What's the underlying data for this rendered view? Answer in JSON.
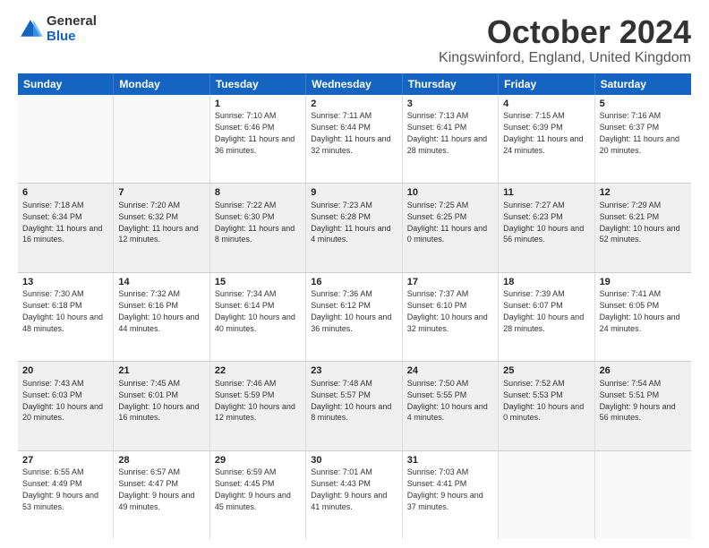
{
  "logo": {
    "general": "General",
    "blue": "Blue"
  },
  "title": "October 2024",
  "subtitle": "Kingswinford, England, United Kingdom",
  "days": [
    "Sunday",
    "Monday",
    "Tuesday",
    "Wednesday",
    "Thursday",
    "Friday",
    "Saturday"
  ],
  "weeks": [
    [
      {
        "day": "",
        "info": ""
      },
      {
        "day": "",
        "info": ""
      },
      {
        "day": "1",
        "info": "Sunrise: 7:10 AM\nSunset: 6:46 PM\nDaylight: 11 hours and 36 minutes."
      },
      {
        "day": "2",
        "info": "Sunrise: 7:11 AM\nSunset: 6:44 PM\nDaylight: 11 hours and 32 minutes."
      },
      {
        "day": "3",
        "info": "Sunrise: 7:13 AM\nSunset: 6:41 PM\nDaylight: 11 hours and 28 minutes."
      },
      {
        "day": "4",
        "info": "Sunrise: 7:15 AM\nSunset: 6:39 PM\nDaylight: 11 hours and 24 minutes."
      },
      {
        "day": "5",
        "info": "Sunrise: 7:16 AM\nSunset: 6:37 PM\nDaylight: 11 hours and 20 minutes."
      }
    ],
    [
      {
        "day": "6",
        "info": "Sunrise: 7:18 AM\nSunset: 6:34 PM\nDaylight: 11 hours and 16 minutes."
      },
      {
        "day": "7",
        "info": "Sunrise: 7:20 AM\nSunset: 6:32 PM\nDaylight: 11 hours and 12 minutes."
      },
      {
        "day": "8",
        "info": "Sunrise: 7:22 AM\nSunset: 6:30 PM\nDaylight: 11 hours and 8 minutes."
      },
      {
        "day": "9",
        "info": "Sunrise: 7:23 AM\nSunset: 6:28 PM\nDaylight: 11 hours and 4 minutes."
      },
      {
        "day": "10",
        "info": "Sunrise: 7:25 AM\nSunset: 6:25 PM\nDaylight: 11 hours and 0 minutes."
      },
      {
        "day": "11",
        "info": "Sunrise: 7:27 AM\nSunset: 6:23 PM\nDaylight: 10 hours and 56 minutes."
      },
      {
        "day": "12",
        "info": "Sunrise: 7:29 AM\nSunset: 6:21 PM\nDaylight: 10 hours and 52 minutes."
      }
    ],
    [
      {
        "day": "13",
        "info": "Sunrise: 7:30 AM\nSunset: 6:18 PM\nDaylight: 10 hours and 48 minutes."
      },
      {
        "day": "14",
        "info": "Sunrise: 7:32 AM\nSunset: 6:16 PM\nDaylight: 10 hours and 44 minutes."
      },
      {
        "day": "15",
        "info": "Sunrise: 7:34 AM\nSunset: 6:14 PM\nDaylight: 10 hours and 40 minutes."
      },
      {
        "day": "16",
        "info": "Sunrise: 7:36 AM\nSunset: 6:12 PM\nDaylight: 10 hours and 36 minutes."
      },
      {
        "day": "17",
        "info": "Sunrise: 7:37 AM\nSunset: 6:10 PM\nDaylight: 10 hours and 32 minutes."
      },
      {
        "day": "18",
        "info": "Sunrise: 7:39 AM\nSunset: 6:07 PM\nDaylight: 10 hours and 28 minutes."
      },
      {
        "day": "19",
        "info": "Sunrise: 7:41 AM\nSunset: 6:05 PM\nDaylight: 10 hours and 24 minutes."
      }
    ],
    [
      {
        "day": "20",
        "info": "Sunrise: 7:43 AM\nSunset: 6:03 PM\nDaylight: 10 hours and 20 minutes."
      },
      {
        "day": "21",
        "info": "Sunrise: 7:45 AM\nSunset: 6:01 PM\nDaylight: 10 hours and 16 minutes."
      },
      {
        "day": "22",
        "info": "Sunrise: 7:46 AM\nSunset: 5:59 PM\nDaylight: 10 hours and 12 minutes."
      },
      {
        "day": "23",
        "info": "Sunrise: 7:48 AM\nSunset: 5:57 PM\nDaylight: 10 hours and 8 minutes."
      },
      {
        "day": "24",
        "info": "Sunrise: 7:50 AM\nSunset: 5:55 PM\nDaylight: 10 hours and 4 minutes."
      },
      {
        "day": "25",
        "info": "Sunrise: 7:52 AM\nSunset: 5:53 PM\nDaylight: 10 hours and 0 minutes."
      },
      {
        "day": "26",
        "info": "Sunrise: 7:54 AM\nSunset: 5:51 PM\nDaylight: 9 hours and 56 minutes."
      }
    ],
    [
      {
        "day": "27",
        "info": "Sunrise: 6:55 AM\nSunset: 4:49 PM\nDaylight: 9 hours and 53 minutes."
      },
      {
        "day": "28",
        "info": "Sunrise: 6:57 AM\nSunset: 4:47 PM\nDaylight: 9 hours and 49 minutes."
      },
      {
        "day": "29",
        "info": "Sunrise: 6:59 AM\nSunset: 4:45 PM\nDaylight: 9 hours and 45 minutes."
      },
      {
        "day": "30",
        "info": "Sunrise: 7:01 AM\nSunset: 4:43 PM\nDaylight: 9 hours and 41 minutes."
      },
      {
        "day": "31",
        "info": "Sunrise: 7:03 AM\nSunset: 4:41 PM\nDaylight: 9 hours and 37 minutes."
      },
      {
        "day": "",
        "info": ""
      },
      {
        "day": "",
        "info": ""
      }
    ]
  ]
}
